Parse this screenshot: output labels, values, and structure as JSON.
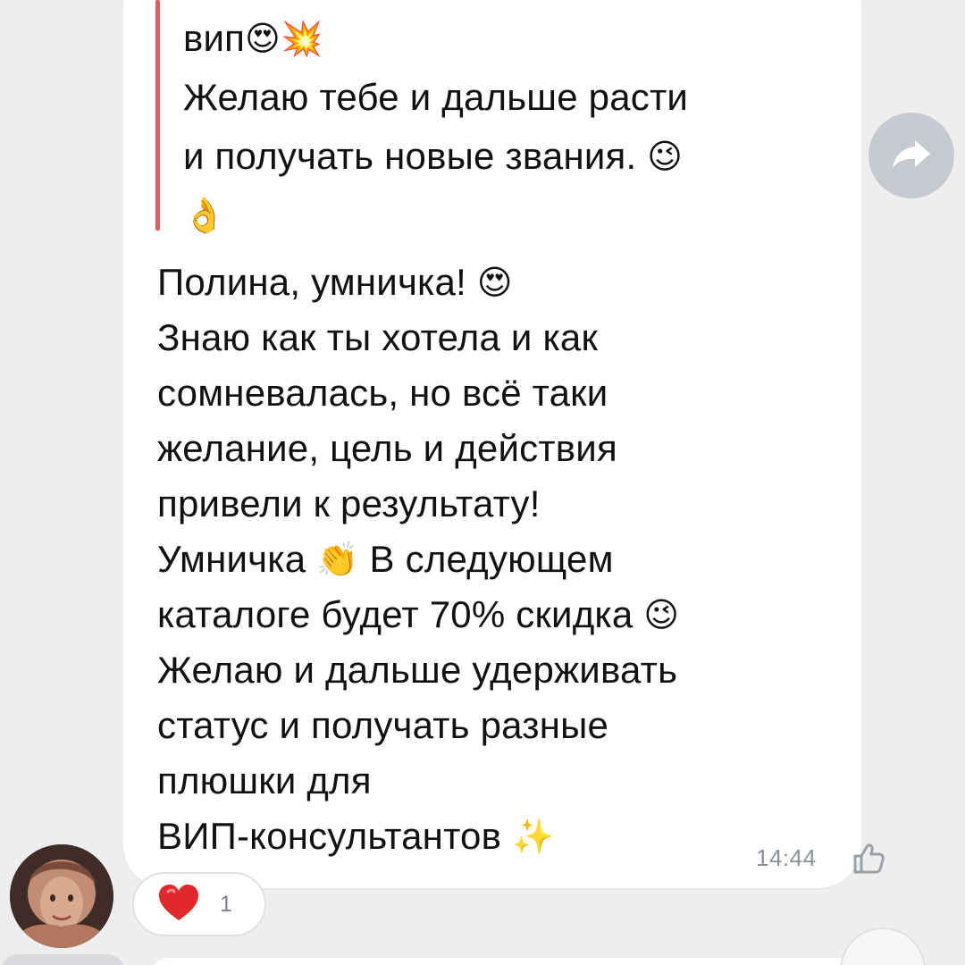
{
  "message": {
    "quote_lines": [
      "вип",
      "Желаю тебе и дальше расти",
      "и получать новые звания."
    ],
    "quote_emojis": {
      "first": "😍",
      "second": "💥",
      "wink": "😉",
      "ok": "👌"
    },
    "body_lines": [
      "Полина, умничка!",
      "Знаю как ты хотела и как",
      "сомневалась, но всё таки",
      "желание, цель и действия",
      "привели к результату!",
      "Умничка",
      "В следующем",
      "каталоге будет 70% скидка",
      "Желаю и дальше удерживать",
      "статус и получать разные",
      "плюшки для",
      "ВИП-консультантов"
    ],
    "body_emojis": {
      "love": "😍",
      "clap": "👏",
      "wink": "😉",
      "sparkles": "✨"
    },
    "time": "14:44"
  },
  "reaction": {
    "emoji": "❤️",
    "count": "1"
  },
  "colors": {
    "background": "#eeeeef",
    "bubble": "#ffffff",
    "quote_bar": "#e45a5c",
    "time": "#8d9299",
    "forward_button": "#c6c9cf"
  },
  "icons": {
    "forward": "forward-arrow-icon",
    "like": "thumbs-up-outline-icon",
    "avatar": "user-avatar-photo"
  }
}
